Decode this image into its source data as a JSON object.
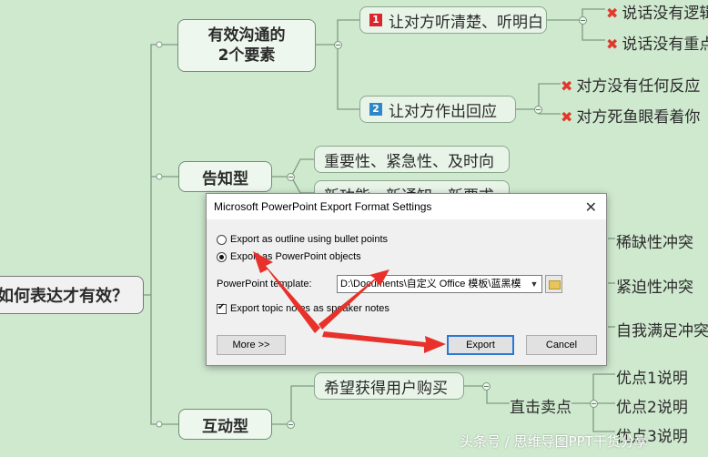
{
  "mindmap": {
    "center": "如何表达才有效？",
    "branches": [
      {
        "label": "有效沟通的\n2个要素"
      },
      {
        "label": "告知型"
      },
      {
        "label": "互动型"
      }
    ],
    "effective": [
      {
        "num": "1",
        "label": "让对方听清楚、听明白",
        "children": [
          "说话没有逻辑",
          "说话没有重点"
        ]
      },
      {
        "num": "2",
        "label": "让对方作出回应",
        "children": [
          "对方没有任何反应",
          "对方死鱼眼看着你"
        ]
      }
    ],
    "inform": [
      "重要性、紧急性、及时向",
      "新功能、新通知、新要求"
    ],
    "conflict": [
      "稀缺性冲突",
      "紧迫性冲突",
      "自我满足冲突"
    ],
    "interactive": {
      "goal": "希望获得用户购买",
      "sell": "直击卖点",
      "points": [
        "优点1说明",
        "优点2说明",
        "优点3说明"
      ]
    },
    "colors": {
      "badge1": "#d9262c",
      "badge2": "#2f86c8",
      "arrow": "#e8312a"
    }
  },
  "dialog": {
    "title": "Microsoft PowerPoint Export Format Settings",
    "close": "✕",
    "option_outline": "Export as outline using bullet points",
    "option_objects": "Export as PowerPoint objects",
    "template_label": "PowerPoint template:",
    "template_value": "D:\\Documents\\自定义 Office 模板\\蓝黑模",
    "notes_label": "Export topic notes as speaker notes",
    "more_button": "More >>",
    "export_button": "Export",
    "cancel_button": "Cancel"
  },
  "watermark": "头条号 / 思维导图PPT干货分享"
}
